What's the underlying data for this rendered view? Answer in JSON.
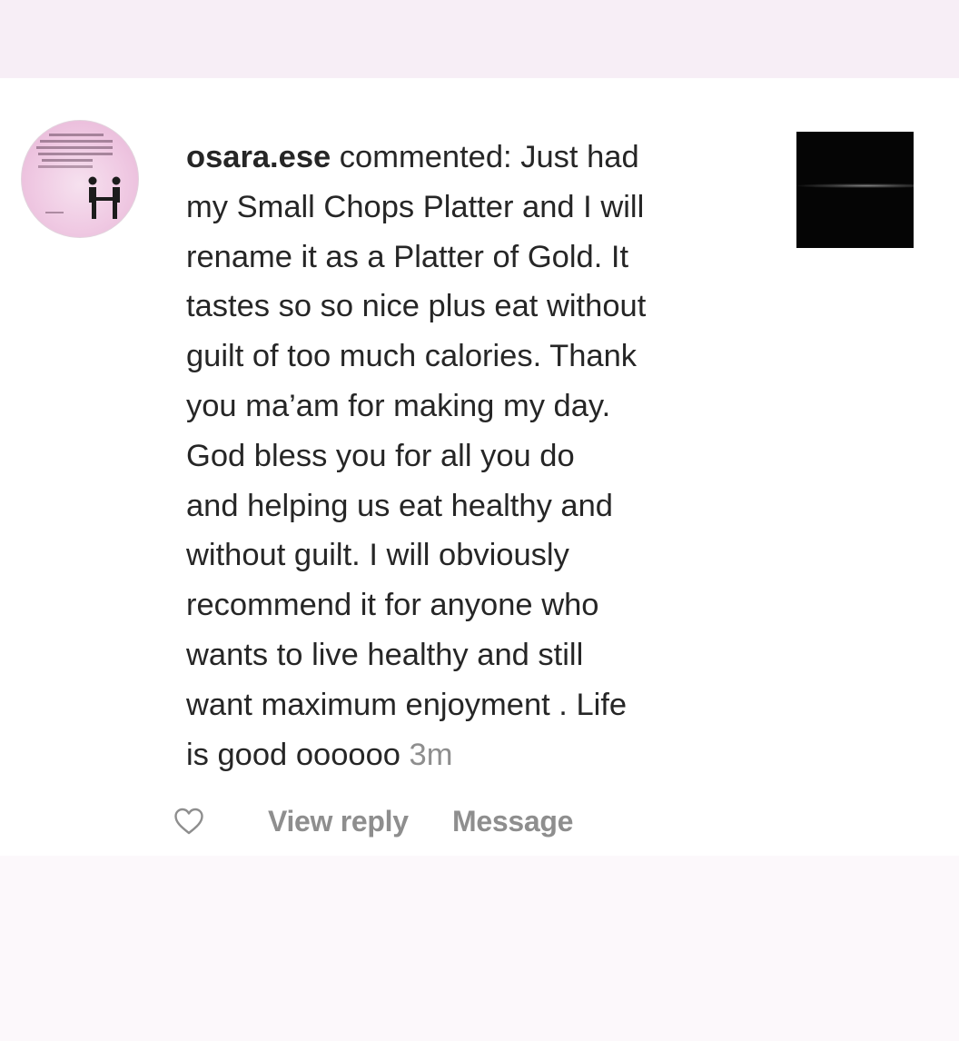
{
  "comment": {
    "username": "osara.ese",
    "lines": [
      " commented: Just had",
      "my Small Chops Platter and I will",
      "rename it as a Platter of Gold. It",
      "tastes so so nice plus eat without",
      "guilt of too much calories. Thank",
      "you ma’am for making my day.",
      "God bless you for all you do",
      "and helping us eat healthy and",
      "without guilt.  I will obviously",
      "recommend it for anyone who",
      "wants to live healthy and still",
      "want maximum enjoyment . Life",
      "is good oooooo "
    ],
    "timestamp": "3m"
  },
  "avatar": {
    "image_text": "lot of problems in t world would disappear if we talked to each other instead of about each other"
  },
  "actions": {
    "like_icon": "heart-outline-icon",
    "view_reply_label": "View reply",
    "message_label": "Message"
  },
  "colors": {
    "text": "#262626",
    "muted": "#8e8e8e",
    "top_band": "#f7eef6",
    "bottom_band": "#fcf8fb"
  }
}
